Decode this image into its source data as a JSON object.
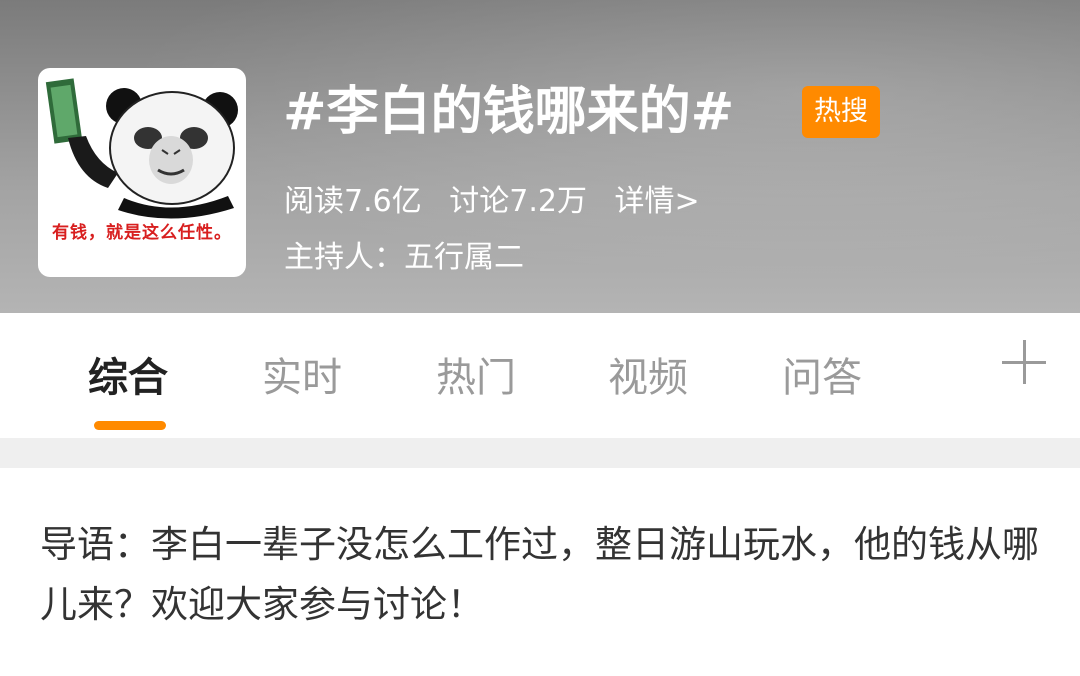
{
  "header": {
    "avatar_caption": "有钱，就是这么任性。",
    "title": "#李白的钱哪来的#",
    "badge": "热搜",
    "reads": "阅读7.6亿",
    "discussions": "讨论7.2万",
    "details_link": "详情>",
    "host": "主持人：五行属二"
  },
  "tabs": [
    {
      "label": "综合",
      "active": true
    },
    {
      "label": "实时",
      "active": false
    },
    {
      "label": "热门",
      "active": false
    },
    {
      "label": "视频",
      "active": false
    },
    {
      "label": "问答",
      "active": false
    }
  ],
  "icons": {
    "add_tab": "plus-icon"
  },
  "colors": {
    "accent": "#ff8a00",
    "header_bg": "#9e9e9e",
    "caption_red": "#d81f1f"
  },
  "intro": {
    "text": "导语：李白一辈子没怎么工作过，整日游山玩水，他的钱从哪儿来？欢迎大家参与讨论！"
  }
}
